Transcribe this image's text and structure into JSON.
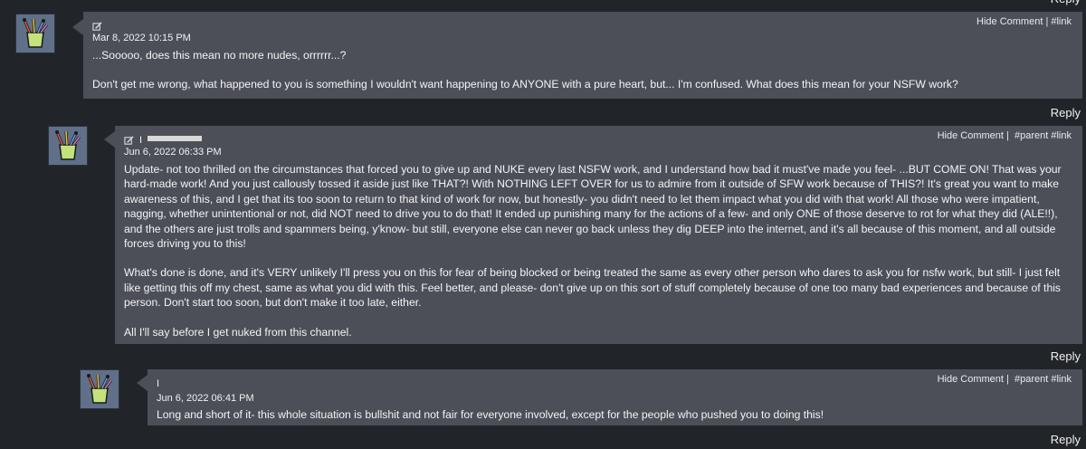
{
  "reply_label": "Reply",
  "comments": [
    {
      "actions": {
        "hide": "Hide Comment",
        "sep": " | ",
        "link": "#link"
      },
      "date": "Mar 8, 2022 10:15 PM",
      "paragraphs": [
        "...Sooooo, does this mean no more nudes, orrrrrr...?",
        "Don't get me wrong, what happened to you is something I wouldn't want happening to ANYONE with a pure heart, but... I'm confused. What does this mean for your NSFW work?"
      ]
    },
    {
      "actions": {
        "hide": "Hide Comment",
        "sep": " | ",
        "parent": "#parent",
        "link": "#link"
      },
      "author_initial": "I",
      "date": "Jun 6, 2022 06:33 PM",
      "paragraphs": [
        "Update- not too thrilled on the circumstances that forced you to give up and NUKE every last NSFW work, and I understand how bad it must've made you feel- ...BUT COME ON! That was your hard-made work! And you just callously tossed it aside just like THAT?! With NOTHING LEFT OVER for us to admire from it outside of SFW work because of THIS?! It's great you want to make awareness of this, and I get that its too soon to return to that kind of work for now, but honestly- you didn't need to let them impact what you did with that work! All those who were impatient, nagging, whether unintentional or not, did NOT need to drive you to do that! It ended up punishing many for the actions of a few- and only ONE of those deserve to rot for what they did (ALE!!), and the others are just trolls and spammers being, y'know- but still, everyone else can never go back unless they dig DEEP into the internet, and it's all because of this moment, and all outside forces driving you to this!",
        "What's done is done, and it's VERY unlikely I'll press you on this for fear of being blocked or being treated the same as every other person who dares to ask you for nsfw work, but still- I just felt like getting this off my chest, same as what you did with this. Feel better, and please- don't give up on this sort of stuff completely because of one too many bad experiences and because of this person. Don't start too soon, but don't make it too late, either.",
        "All I'll say before I get nuked from this channel."
      ]
    },
    {
      "actions": {
        "hide": "Hide Comment",
        "sep": " | ",
        "parent": "#parent",
        "link": "#link"
      },
      "author_initial": "I",
      "date": "Jun 6, 2022 06:41 PM",
      "paragraphs": [
        "Long and short of it- this whole situation is bullshit and not fair for everyone involved, except for the people who pushed you to doing this!"
      ]
    }
  ]
}
